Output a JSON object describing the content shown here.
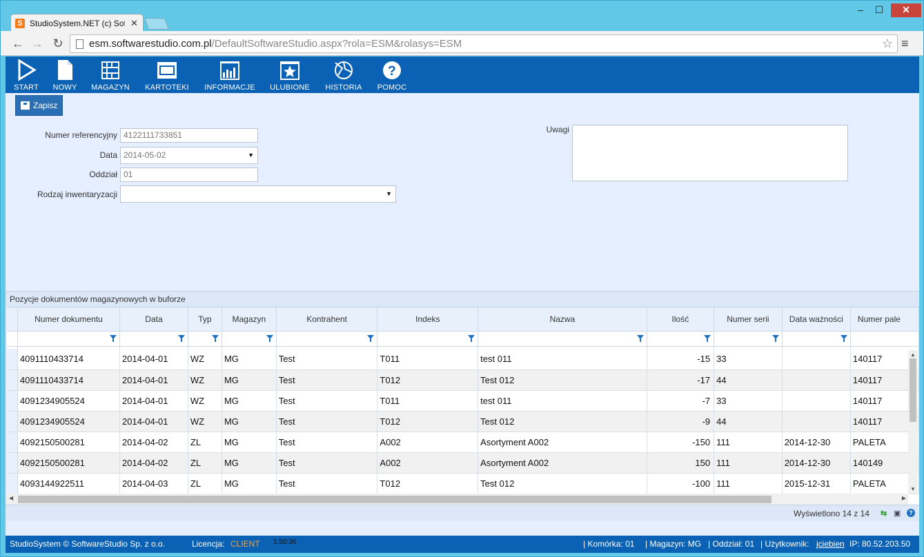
{
  "browser": {
    "tab_title": "StudioSystem.NET (c) Soft",
    "favicon": "S",
    "url_host": "esm.softwarestudio.com.pl",
    "url_rest": "/DefaultSoftwareStudio.aspx?rola=ESM&rolasys=ESM"
  },
  "toolbar": {
    "items": [
      {
        "label": "START",
        "icon": "play-icon"
      },
      {
        "label": "NOWY",
        "icon": "new-document-icon"
      },
      {
        "label": "MAGAZYN",
        "icon": "warehouse-grid-icon"
      },
      {
        "label": "KARTOTEKI",
        "icon": "card-index-icon"
      },
      {
        "label": "INFORMACJE",
        "icon": "bar-chart-icon"
      },
      {
        "label": "ULUBIONE",
        "icon": "star-icon"
      },
      {
        "label": "HISTORIA",
        "icon": "history-icon"
      },
      {
        "label": "POMOC",
        "icon": "help-icon"
      }
    ],
    "save_label": "Zapisz"
  },
  "form": {
    "ref_label": "Numer referencyjny",
    "ref_value": "4122111733851",
    "date_label": "Data",
    "date_value": "2014-05-02",
    "branch_label": "Oddział",
    "branch_value": "01",
    "inv_type_label": "Rodzaj inwentaryzacji",
    "inv_type_value": "",
    "notes_label": "Uwagi"
  },
  "grid": {
    "caption": "Pozycje dokumentów magazynowych w buforze",
    "columns": [
      "Numer dokumentu",
      "Data",
      "Typ",
      "Magazyn",
      "Kontrahent",
      "Indeks",
      "Nazwa",
      "Ilość",
      "Numer serii",
      "Data ważności",
      "Numer pale"
    ],
    "rows": [
      [
        "4091110433714",
        "2014-04-01",
        "WZ",
        "MG",
        "Test",
        "T011",
        "test 011",
        "-15",
        "33",
        "",
        "140117"
      ],
      [
        "4091110433714",
        "2014-04-01",
        "WZ",
        "MG",
        "Test",
        "T012",
        "Test 012",
        "-17",
        "44",
        "",
        "140117"
      ],
      [
        "4091234905524",
        "2014-04-01",
        "WZ",
        "MG",
        "Test",
        "T011",
        "test 011",
        "-7",
        "33",
        "",
        "140117"
      ],
      [
        "4091234905524",
        "2014-04-01",
        "WZ",
        "MG",
        "Test",
        "T012",
        "Test 012",
        "-9",
        "44",
        "",
        "140117"
      ],
      [
        "4092150500281",
        "2014-04-02",
        "ZL",
        "MG",
        "Test",
        "A002",
        "Asortyment A002",
        "-150",
        "111",
        "2014-12-30",
        "PALETA"
      ],
      [
        "4092150500281",
        "2014-04-02",
        "ZL",
        "MG",
        "Test",
        "A002",
        "Asortyment A002",
        "150",
        "111",
        "2014-12-30",
        "140149"
      ],
      [
        "4093144922511",
        "2014-04-03",
        "ZL",
        "MG",
        "Test",
        "T012",
        "Test 012",
        "-100",
        "111",
        "2015-12-31",
        "PALETA"
      ]
    ],
    "pager_text": "Wyświetlono 14 z 14"
  },
  "status": {
    "copyright": "StudioSystem © SoftwareStudio Sp. z o.o.",
    "license_label": "Licencja:",
    "license_value": "CLIENT",
    "timer": "1:50:36",
    "cell": "| Komórka: 01",
    "warehouse": "| Magazyn: MG",
    "branch": "| Oddział: 01",
    "user_label": "| Użytkownik:",
    "user": "jciebien",
    "ip": "IP: 80.52.203.50"
  },
  "colors": {
    "toolbar": "#0b61b4",
    "page_bg": "#e6efff",
    "license_accent": "#f2a23c",
    "window_frame": "#61c8e8"
  }
}
